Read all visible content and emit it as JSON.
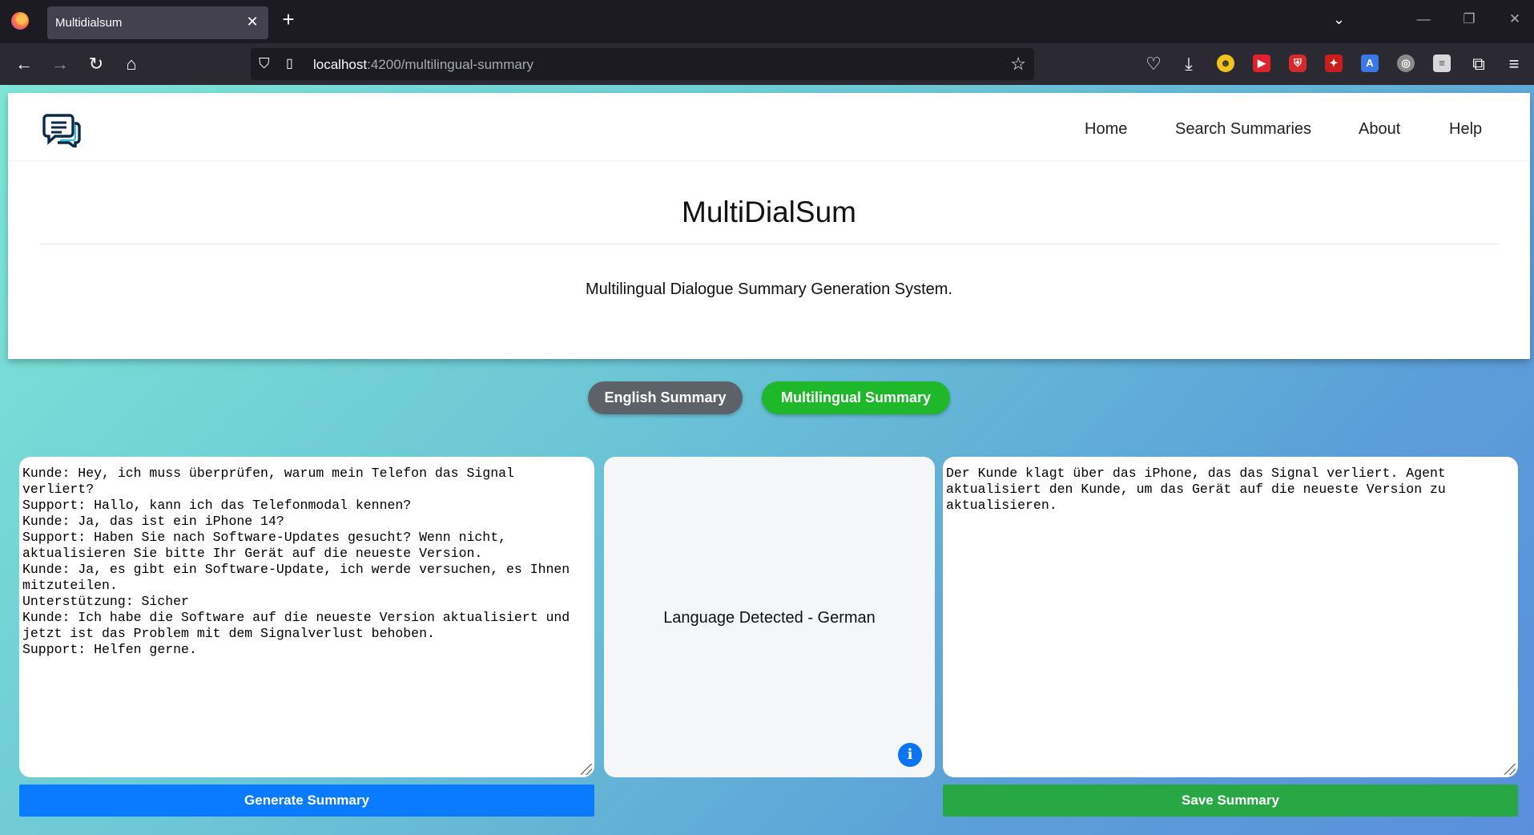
{
  "browser": {
    "tab_title": "Multidialsum",
    "tab_close": "✕",
    "new_tab": "+",
    "url_host": "localhost",
    "url_path": ":4200/multilingual-summary"
  },
  "nav": {
    "items": [
      "Home",
      "Search Summaries",
      "About",
      "Help"
    ]
  },
  "hero": {
    "title": "MultiDialSum",
    "subtitle": "Multilingual Dialogue Summary Generation System."
  },
  "mode_buttons": {
    "english": "English Summary",
    "multilingual": "Multilingual Summary"
  },
  "dialogue_input": "Kunde: Hey, ich muss überprüfen, warum mein Telefon das Signal verliert?\nSupport: Hallo, kann ich das Telefonmodal kennen?\nKunde: Ja, das ist ein iPhone 14?\nSupport: Haben Sie nach Software-Updates gesucht? Wenn nicht,\naktualisieren Sie bitte Ihr Gerät auf die neueste Version.\nKunde: Ja, es gibt ein Software-Update, ich werde versuchen, es Ihnen\nmitzuteilen.\nUnterstützung: Sicher\nKunde: Ich habe die Software auf die neueste Version aktualisiert und\njetzt ist das Problem mit dem Signalverlust behoben.\nSupport: Helfen gerne.",
  "language_detected": "Language Detected - German",
  "info_label": "i",
  "summary_output": "Der Kunde klagt über das iPhone, das das Signal verliert. Agent\naktualisiert den Kunde, um das Gerät auf die neueste Version zu\naktualisieren.",
  "actions": {
    "generate": "Generate Summary",
    "save": "Save Summary"
  },
  "colors": {
    "generate_button": "#0a7bff",
    "save_button": "#27a844",
    "multilingual_active": "#1eb82a",
    "english_inactive": "#5d6168"
  }
}
